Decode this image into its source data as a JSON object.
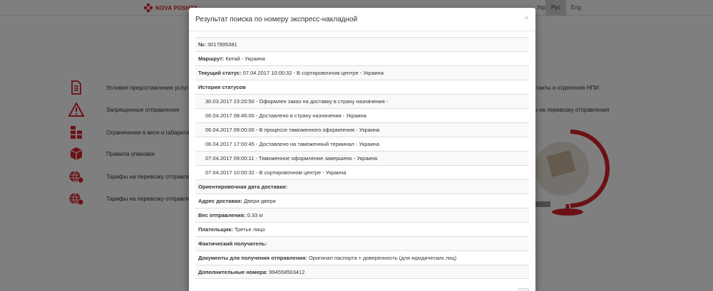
{
  "header": {
    "logo_text": "NOVA POSHTA",
    "languages": [
      {
        "label": "Укр",
        "active": false
      },
      {
        "label": "Рус",
        "active": true
      },
      {
        "label": "Eng",
        "active": false
      }
    ]
  },
  "services": [
    {
      "icon": "document-icon",
      "label": "Условия предоставления услуг"
    },
    {
      "icon": "warning-icon",
      "label": "Запрещенные отправления"
    },
    {
      "icon": "boxes-stack-icon",
      "label": "Ограничения в весе и габаритах"
    },
    {
      "icon": "package-icon",
      "label": "Правила упаковки"
    },
    {
      "icon": "globe-rate-icon",
      "label": "Тарифы на перевозку отправлен"
    },
    {
      "icon": "globe-rate-icon",
      "label": "Тарифы на перевозку отправлен"
    }
  ],
  "right_links": [
    {
      "label": "ктакты и отделения НПИ"
    },
    {
      "label": "ы на перевозку отправления"
    }
  ],
  "modal": {
    "title": "Результат поиска по номеру экспресс-накладной",
    "close": "×",
    "rows": [
      {
        "label": "№:",
        "value": "3017895381"
      },
      {
        "label": "Маршрут:",
        "value": "Китай - Украина"
      },
      {
        "label": "Текущий статус:",
        "value": "07.04.2017 10:00:32 - В сортировочном центре - Украина"
      },
      {
        "label": "История статусов",
        "value": ""
      }
    ],
    "history": [
      "30.03.2017 23:20:50 - Оформлен заказ на доставку в страну назначения -",
      "06.04.2017 08:46:00 - Доставлено в страну назначения - Украина",
      "06.04.2017 09:00:00 - В процессе таможенного оформления - Украина",
      "06.04.2017 17:00:45 - Доставлено на таможенный терминал - Украина",
      "07.04.2017 09:00:11 - Таможенное оформление завершено - Украина",
      "07.04.2017 10:00:32 - В сортировочном центре - Украина"
    ],
    "details": [
      {
        "label": "Ориентировочная дата доставки:",
        "value": ""
      },
      {
        "label": "Адрес доставки:",
        "value": "Двери-двери"
      },
      {
        "label": "Вес отправления:",
        "value": "0.33 кг"
      },
      {
        "label": "Плательщик:",
        "value": "Третье лицо"
      },
      {
        "label": "Фактический получатель:",
        "value": ""
      },
      {
        "label": "Документы для получения отправления:",
        "value": "Оригинал паспорта + доверенность (для юридических лиц)"
      },
      {
        "label": "Дополнительные номера:",
        "value": "994558503412"
      }
    ]
  },
  "colors": {
    "brand": "#d9232d",
    "overlay": "rgba(0,0,0,0.5)"
  }
}
